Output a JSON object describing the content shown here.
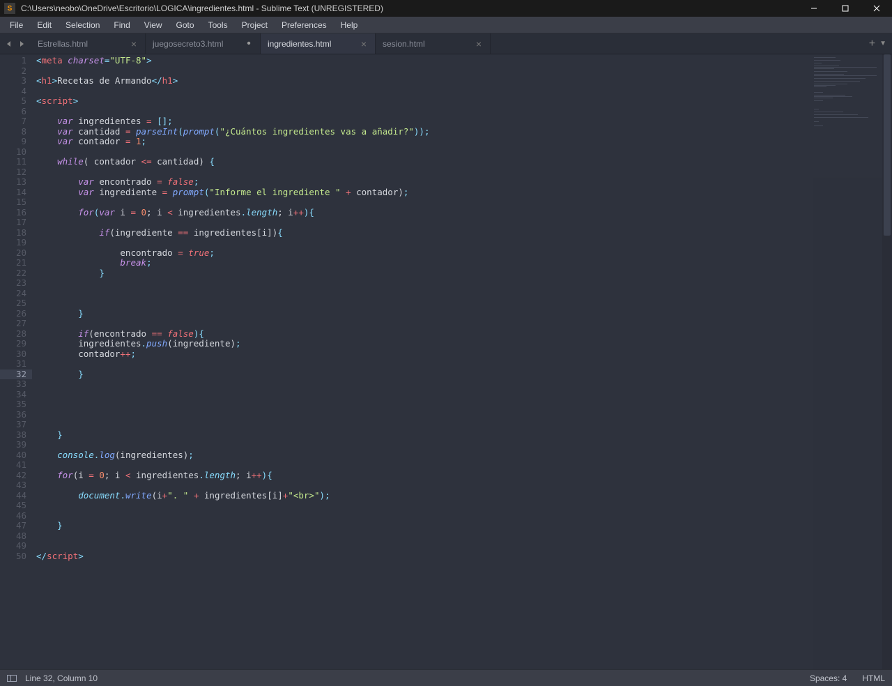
{
  "window": {
    "title": "C:\\Users\\neobo\\OneDrive\\Escritorio\\LOGICA\\ingredientes.html - Sublime Text (UNREGISTERED)"
  },
  "menu": [
    "File",
    "Edit",
    "Selection",
    "Find",
    "View",
    "Goto",
    "Tools",
    "Project",
    "Preferences",
    "Help"
  ],
  "tabs": [
    {
      "label": "Estrellas.html",
      "active": false,
      "dirty": false
    },
    {
      "label": "juegosecreto3.html",
      "active": false,
      "dirty": true
    },
    {
      "label": "ingredientes.html",
      "active": true,
      "dirty": false
    },
    {
      "label": "sesion.html",
      "active": false,
      "dirty": false
    }
  ],
  "editor": {
    "line_count": 50,
    "active_line": 32
  },
  "code_tokens": [
    [
      {
        "t": "<",
        "c": "c-punc"
      },
      {
        "t": "meta",
        "c": "c-elem"
      },
      {
        "t": " ",
        "c": ""
      },
      {
        "t": "charset",
        "c": "c-attr"
      },
      {
        "t": "=",
        "c": "c-punc"
      },
      {
        "t": "\"UTF-8\"",
        "c": "c-str"
      },
      {
        "t": ">",
        "c": "c-punc"
      }
    ],
    [],
    [
      {
        "t": "<",
        "c": "c-punc"
      },
      {
        "t": "h1",
        "c": "c-elem"
      },
      {
        "t": ">",
        "c": "c-punc"
      },
      {
        "t": "Recetas de Armando",
        "c": "c-text"
      },
      {
        "t": "</",
        "c": "c-punc"
      },
      {
        "t": "h1",
        "c": "c-elem"
      },
      {
        "t": ">",
        "c": "c-punc"
      }
    ],
    [],
    [
      {
        "t": "<",
        "c": "c-punc"
      },
      {
        "t": "script",
        "c": "c-elem"
      },
      {
        "t": ">",
        "c": "c-punc"
      }
    ],
    [],
    [
      {
        "t": "    ",
        "c": ""
      },
      {
        "t": "var",
        "c": "c-storage"
      },
      {
        "t": " ingredientes ",
        "c": "c-var"
      },
      {
        "t": "=",
        "c": "c-op"
      },
      {
        "t": " ",
        "c": ""
      },
      {
        "t": "[",
        "c": "c-punc"
      },
      {
        "t": "]",
        "c": "c-punc"
      },
      {
        "t": ";",
        "c": "c-punc"
      }
    ],
    [
      {
        "t": "    ",
        "c": ""
      },
      {
        "t": "var",
        "c": "c-storage"
      },
      {
        "t": " cantidad ",
        "c": "c-var"
      },
      {
        "t": "=",
        "c": "c-op"
      },
      {
        "t": " ",
        "c": ""
      },
      {
        "t": "parseInt",
        "c": "c-func"
      },
      {
        "t": "(",
        "c": "c-punc"
      },
      {
        "t": "prompt",
        "c": "c-func"
      },
      {
        "t": "(",
        "c": "c-punc"
      },
      {
        "t": "\"¿Cuántos ingredientes vas a añadir?\"",
        "c": "c-str"
      },
      {
        "t": "))",
        "c": "c-punc"
      },
      {
        "t": ";",
        "c": "c-punc"
      }
    ],
    [
      {
        "t": "    ",
        "c": ""
      },
      {
        "t": "var",
        "c": "c-storage"
      },
      {
        "t": " contador ",
        "c": "c-var"
      },
      {
        "t": "=",
        "c": "c-op"
      },
      {
        "t": " ",
        "c": ""
      },
      {
        "t": "1",
        "c": "c-num"
      },
      {
        "t": ";",
        "c": "c-punc"
      }
    ],
    [],
    [
      {
        "t": "    ",
        "c": ""
      },
      {
        "t": "while",
        "c": "c-keyw"
      },
      {
        "t": "( contador ",
        "c": "c-var"
      },
      {
        "t": "<=",
        "c": "c-op"
      },
      {
        "t": " cantidad) ",
        "c": "c-var"
      },
      {
        "t": "{",
        "c": "c-punc"
      }
    ],
    [],
    [
      {
        "t": "        ",
        "c": ""
      },
      {
        "t": "var",
        "c": "c-storage"
      },
      {
        "t": " encontrado ",
        "c": "c-var"
      },
      {
        "t": "=",
        "c": "c-op"
      },
      {
        "t": " ",
        "c": ""
      },
      {
        "t": "false",
        "c": "c-const"
      },
      {
        "t": ";",
        "c": "c-punc"
      }
    ],
    [
      {
        "t": "        ",
        "c": ""
      },
      {
        "t": "var",
        "c": "c-storage"
      },
      {
        "t": " ingrediente ",
        "c": "c-var"
      },
      {
        "t": "=",
        "c": "c-op"
      },
      {
        "t": " ",
        "c": ""
      },
      {
        "t": "prompt",
        "c": "c-func"
      },
      {
        "t": "(",
        "c": "c-punc"
      },
      {
        "t": "\"Informe el ingrediente \"",
        "c": "c-str"
      },
      {
        "t": " ",
        "c": ""
      },
      {
        "t": "+",
        "c": "c-op"
      },
      {
        "t": " contador)",
        "c": "c-var"
      },
      {
        "t": ";",
        "c": "c-punc"
      }
    ],
    [],
    [
      {
        "t": "        ",
        "c": ""
      },
      {
        "t": "for",
        "c": "c-keyw"
      },
      {
        "t": "(",
        "c": "c-punc"
      },
      {
        "t": "var",
        "c": "c-storage"
      },
      {
        "t": " i ",
        "c": "c-var"
      },
      {
        "t": "=",
        "c": "c-op"
      },
      {
        "t": " ",
        "c": ""
      },
      {
        "t": "0",
        "c": "c-num"
      },
      {
        "t": "; i ",
        "c": "c-var"
      },
      {
        "t": "<",
        "c": "c-op"
      },
      {
        "t": " ingredientes",
        "c": "c-var"
      },
      {
        "t": ".",
        "c": "c-punc"
      },
      {
        "t": "length",
        "c": "c-support"
      },
      {
        "t": "; i",
        "c": "c-var"
      },
      {
        "t": "++",
        "c": "c-op"
      },
      {
        "t": ")",
        "c": "c-punc"
      },
      {
        "t": "{",
        "c": "c-punc"
      }
    ],
    [],
    [
      {
        "t": "            ",
        "c": ""
      },
      {
        "t": "if",
        "c": "c-keyw"
      },
      {
        "t": "(ingrediente ",
        "c": "c-var"
      },
      {
        "t": "==",
        "c": "c-op"
      },
      {
        "t": " ingredientes[i])",
        "c": "c-var"
      },
      {
        "t": "{",
        "c": "c-punc"
      }
    ],
    [],
    [
      {
        "t": "                encontrado ",
        "c": "c-var"
      },
      {
        "t": "=",
        "c": "c-op"
      },
      {
        "t": " ",
        "c": ""
      },
      {
        "t": "true",
        "c": "c-const"
      },
      {
        "t": ";",
        "c": "c-punc"
      }
    ],
    [
      {
        "t": "                ",
        "c": ""
      },
      {
        "t": "break",
        "c": "c-keyw"
      },
      {
        "t": ";",
        "c": "c-punc"
      }
    ],
    [
      {
        "t": "            ",
        "c": ""
      },
      {
        "t": "}",
        "c": "c-punc"
      }
    ],
    [],
    [],
    [],
    [
      {
        "t": "        ",
        "c": ""
      },
      {
        "t": "}",
        "c": "c-punc"
      }
    ],
    [],
    [
      {
        "t": "        ",
        "c": ""
      },
      {
        "t": "if",
        "c": "c-keyw"
      },
      {
        "t": "(encontrado ",
        "c": "c-var"
      },
      {
        "t": "==",
        "c": "c-op"
      },
      {
        "t": " ",
        "c": ""
      },
      {
        "t": "false",
        "c": "c-const"
      },
      {
        "t": ")",
        "c": "c-punc"
      },
      {
        "t": "{",
        "c": "c-punc"
      }
    ],
    [
      {
        "t": "        ingredientes",
        "c": "c-var"
      },
      {
        "t": ".",
        "c": "c-punc"
      },
      {
        "t": "push",
        "c": "c-func"
      },
      {
        "t": "(ingrediente)",
        "c": "c-var"
      },
      {
        "t": ";",
        "c": "c-punc"
      }
    ],
    [
      {
        "t": "        contador",
        "c": "c-var"
      },
      {
        "t": "++",
        "c": "c-op"
      },
      {
        "t": ";",
        "c": "c-punc"
      }
    ],
    [],
    [
      {
        "t": "        ",
        "c": ""
      },
      {
        "t": "}",
        "c": "c-punc"
      }
    ],
    [],
    [],
    [],
    [],
    [],
    [
      {
        "t": "    ",
        "c": ""
      },
      {
        "t": "}",
        "c": "c-punc"
      }
    ],
    [],
    [
      {
        "t": "    ",
        "c": ""
      },
      {
        "t": "console",
        "c": "c-support"
      },
      {
        "t": ".",
        "c": "c-punc"
      },
      {
        "t": "log",
        "c": "c-func"
      },
      {
        "t": "(ingredientes)",
        "c": "c-var"
      },
      {
        "t": ";",
        "c": "c-punc"
      }
    ],
    [],
    [
      {
        "t": "    ",
        "c": ""
      },
      {
        "t": "for",
        "c": "c-keyw"
      },
      {
        "t": "(i ",
        "c": "c-var"
      },
      {
        "t": "=",
        "c": "c-op"
      },
      {
        "t": " ",
        "c": ""
      },
      {
        "t": "0",
        "c": "c-num"
      },
      {
        "t": "; i ",
        "c": "c-var"
      },
      {
        "t": "<",
        "c": "c-op"
      },
      {
        "t": " ingredientes",
        "c": "c-var"
      },
      {
        "t": ".",
        "c": "c-punc"
      },
      {
        "t": "length",
        "c": "c-support"
      },
      {
        "t": "; i",
        "c": "c-var"
      },
      {
        "t": "++",
        "c": "c-op"
      },
      {
        "t": ")",
        "c": "c-punc"
      },
      {
        "t": "{",
        "c": "c-punc"
      }
    ],
    [],
    [
      {
        "t": "        ",
        "c": ""
      },
      {
        "t": "document",
        "c": "c-support"
      },
      {
        "t": ".",
        "c": "c-punc"
      },
      {
        "t": "write",
        "c": "c-func"
      },
      {
        "t": "(i",
        "c": "c-var"
      },
      {
        "t": "+",
        "c": "c-op"
      },
      {
        "t": "\". \"",
        "c": "c-str"
      },
      {
        "t": " ",
        "c": ""
      },
      {
        "t": "+",
        "c": "c-op"
      },
      {
        "t": " ingredientes[i]",
        "c": "c-var"
      },
      {
        "t": "+",
        "c": "c-op"
      },
      {
        "t": "\"<br>\"",
        "c": "c-str"
      },
      {
        "t": ")",
        "c": "c-punc"
      },
      {
        "t": ";",
        "c": "c-punc"
      }
    ],
    [],
    [],
    [
      {
        "t": "    ",
        "c": ""
      },
      {
        "t": "}",
        "c": "c-punc"
      }
    ],
    [],
    [],
    [
      {
        "t": "</",
        "c": "c-punc"
      },
      {
        "t": "script",
        "c": "c-elem"
      },
      {
        "t": ">",
        "c": "c-punc"
      }
    ]
  ],
  "status": {
    "position": "Line 32, Column 10",
    "spaces": "Spaces: 4",
    "syntax": "HTML"
  }
}
